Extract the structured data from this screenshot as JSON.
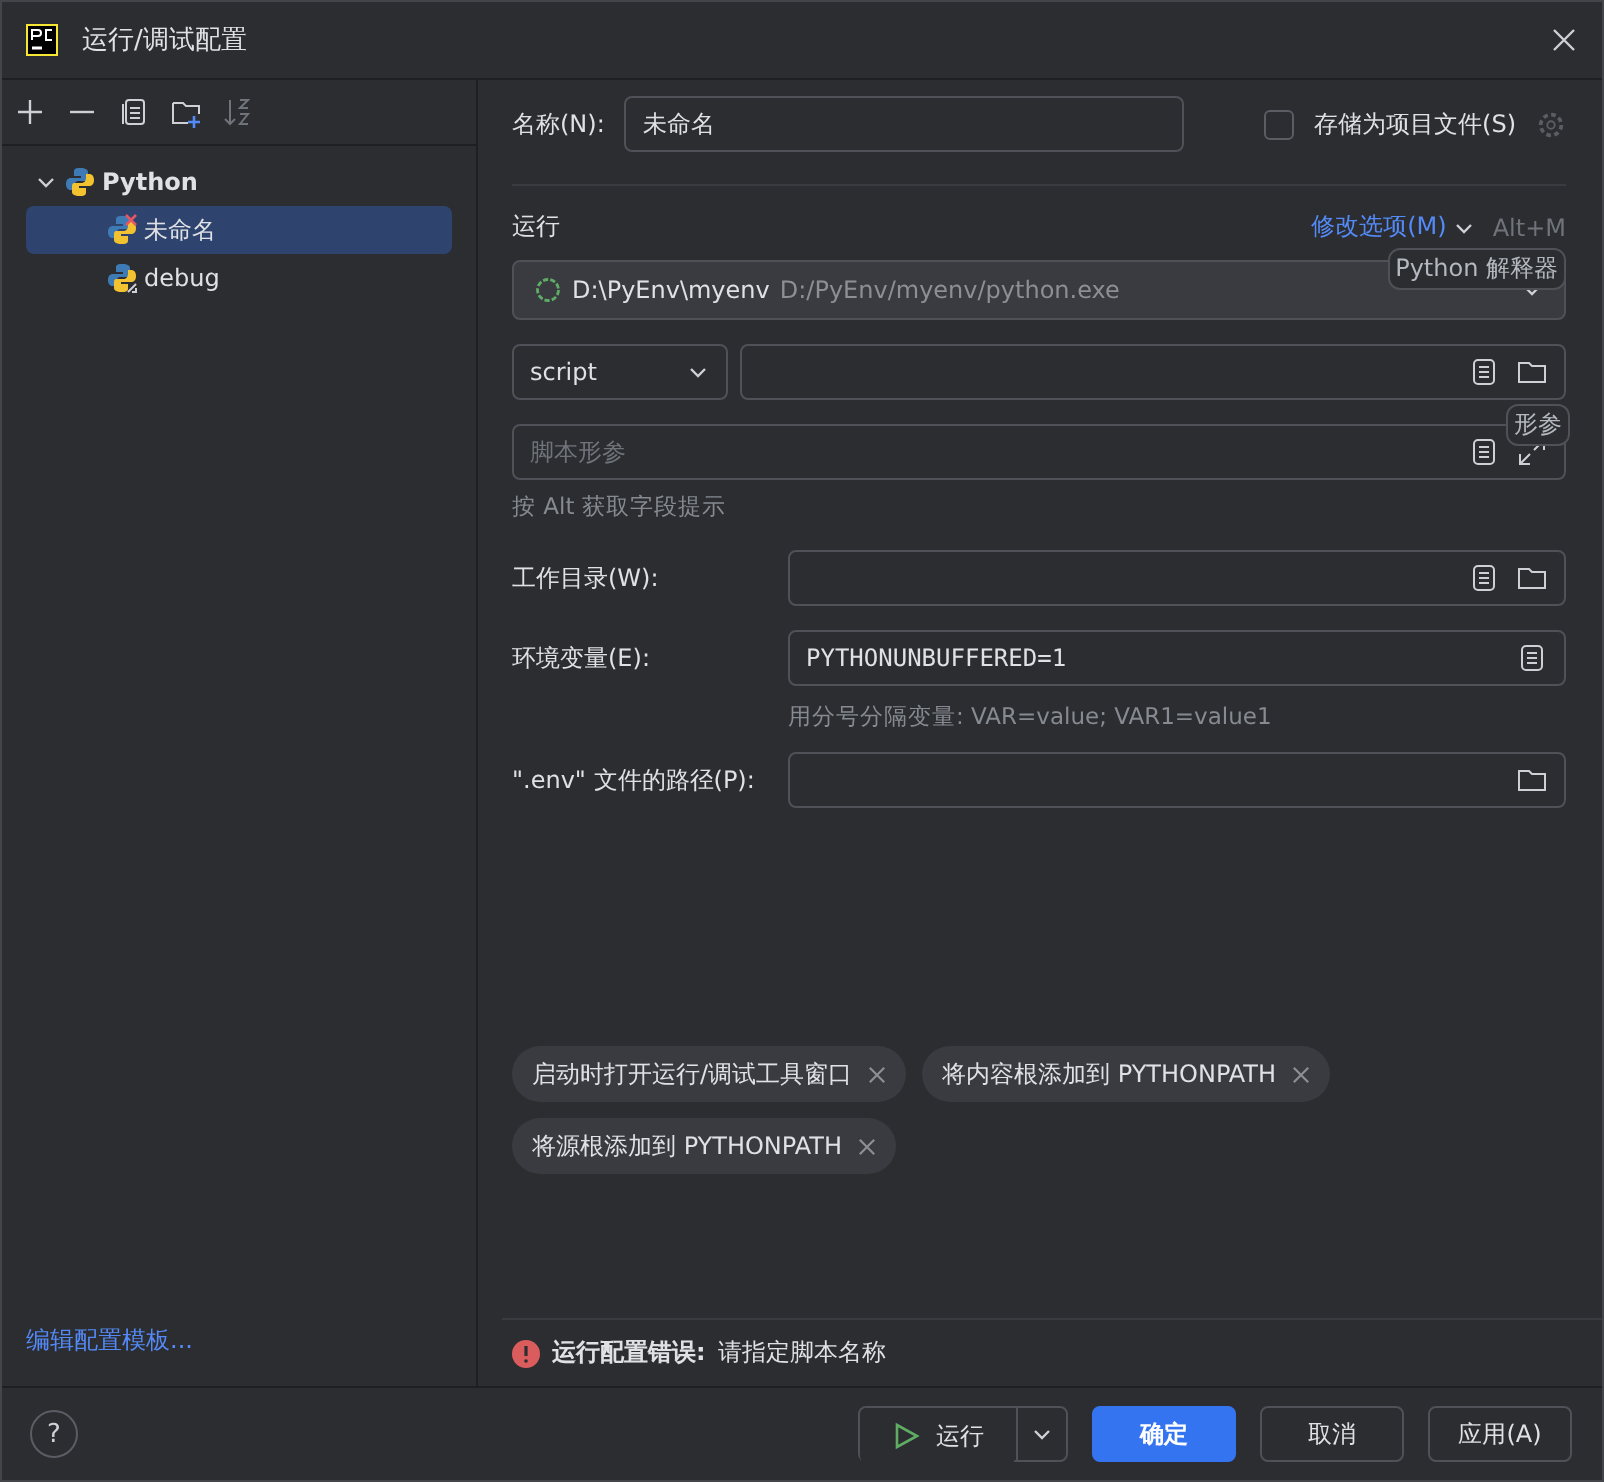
{
  "window": {
    "title": "运行/调试配置"
  },
  "tree": [
    {
      "label": "Python",
      "expanded": true,
      "children": [
        {
          "label": "未命名",
          "selected": true,
          "error": true
        },
        {
          "label": "debug",
          "selected": false,
          "error": false
        }
      ]
    }
  ],
  "templates_link": "编辑配置模板...",
  "name": {
    "label": "名称(N):",
    "value": "未命名"
  },
  "store_as_file": {
    "label": "存储为项目文件(S)",
    "checked": false
  },
  "run_section": {
    "title": "运行",
    "modify_options": "修改选项(M)",
    "shortcut": "Alt+M",
    "tooltip": "Python 解释器"
  },
  "interpreter": {
    "name": "D:\\PyEnv\\myenv",
    "path": "D:/PyEnv/myenv/python.exe"
  },
  "script": {
    "type": "script",
    "tooltip": "形参",
    "params_placeholder": "脚本形参",
    "hint": "按 Alt 获取字段提示"
  },
  "fields": [
    {
      "label": "工作目录(W):"
    },
    {
      "label": "环境变量(E):",
      "value": "PYTHONUNBUFFERED=1",
      "hint": "用分号分隔变量: VAR=value; VAR1=value1"
    },
    {
      "label": "\".env\" 文件的路径(P):"
    }
  ],
  "tags": [
    "启动时打开运行/调试工具窗口",
    "将内容根添加到 PYTHONPATH",
    "将源根添加到 PYTHONPATH"
  ],
  "error": {
    "title": "运行配置错误:",
    "message": "请指定脚本名称"
  },
  "help": "?",
  "buttons": {
    "run": "运行",
    "ok": "确定",
    "cancel": "取消",
    "apply": "应用(A)"
  }
}
